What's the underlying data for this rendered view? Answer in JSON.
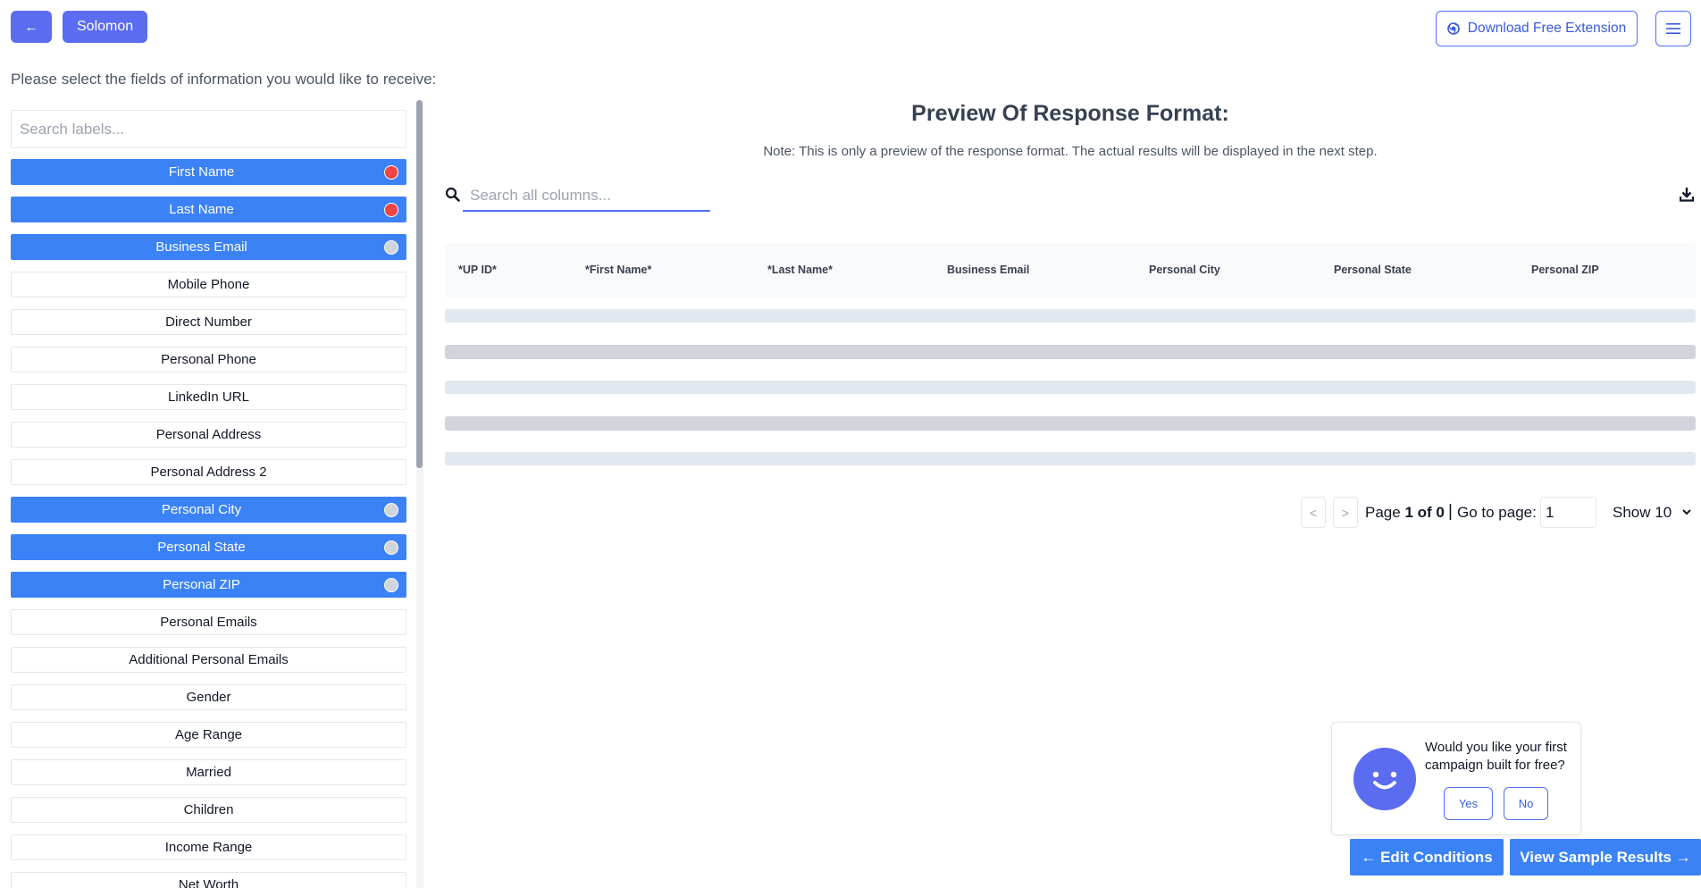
{
  "header": {
    "back_label": "←",
    "user_name": "Solomon",
    "extension_button": "Download Free Extension",
    "extension_icon": "chrome-icon",
    "menu_icon": "hamburger-icon"
  },
  "instructions": "Please select the fields of information you would like to receive:",
  "label_search": {
    "placeholder": "Search labels..."
  },
  "fields": [
    {
      "label": "First Name",
      "selected": true,
      "dot": "red"
    },
    {
      "label": "Last Name",
      "selected": true,
      "dot": "red"
    },
    {
      "label": "Business Email",
      "selected": true,
      "dot": "gray"
    },
    {
      "label": "Mobile Phone",
      "selected": false
    },
    {
      "label": "Direct Number",
      "selected": false
    },
    {
      "label": "Personal Phone",
      "selected": false
    },
    {
      "label": "LinkedIn URL",
      "selected": false
    },
    {
      "label": "Personal Address",
      "selected": false
    },
    {
      "label": "Personal Address 2",
      "selected": false
    },
    {
      "label": "Personal City",
      "selected": true,
      "dot": "gray"
    },
    {
      "label": "Personal State",
      "selected": true,
      "dot": "gray"
    },
    {
      "label": "Personal ZIP",
      "selected": true,
      "dot": "gray"
    },
    {
      "label": "Personal Emails",
      "selected": false
    },
    {
      "label": "Additional Personal Emails",
      "selected": false
    },
    {
      "label": "Gender",
      "selected": false
    },
    {
      "label": "Age Range",
      "selected": false
    },
    {
      "label": "Married",
      "selected": false
    },
    {
      "label": "Children",
      "selected": false
    },
    {
      "label": "Income Range",
      "selected": false
    },
    {
      "label": "Net Worth",
      "selected": false
    }
  ],
  "colors": {
    "accent": "#3b82f6",
    "brand": "#5b6cf0",
    "required_dot": "#ef4444",
    "optional_dot": "#d1d5db",
    "skeleton_light": "#e2e8f0",
    "skeleton_dark": "#d1d5db"
  },
  "preview": {
    "title": "Preview Of Response Format:",
    "note": "Note: This is only a preview of the response format. The actual results will be displayed in the next step.",
    "search_placeholder": "Search all columns...",
    "columns": [
      "*UP ID*",
      "*First Name*",
      "*Last Name*",
      "Business Email",
      "Personal City",
      "Personal State",
      "Personal ZIP"
    ]
  },
  "pagination": {
    "prev": "<",
    "next": ">",
    "page_prefix": "Page",
    "page_value": "1 of 0",
    "separator": "|",
    "goto_label": "Go to page:",
    "goto_value": "1",
    "show_label": "Show 10"
  },
  "popup": {
    "question": "Would you like your first campaign built for free?",
    "yes": "Yes",
    "no": "No"
  },
  "footer": {
    "edit_conditions": "← Edit Conditions",
    "view_sample": "View Sample Results →"
  }
}
